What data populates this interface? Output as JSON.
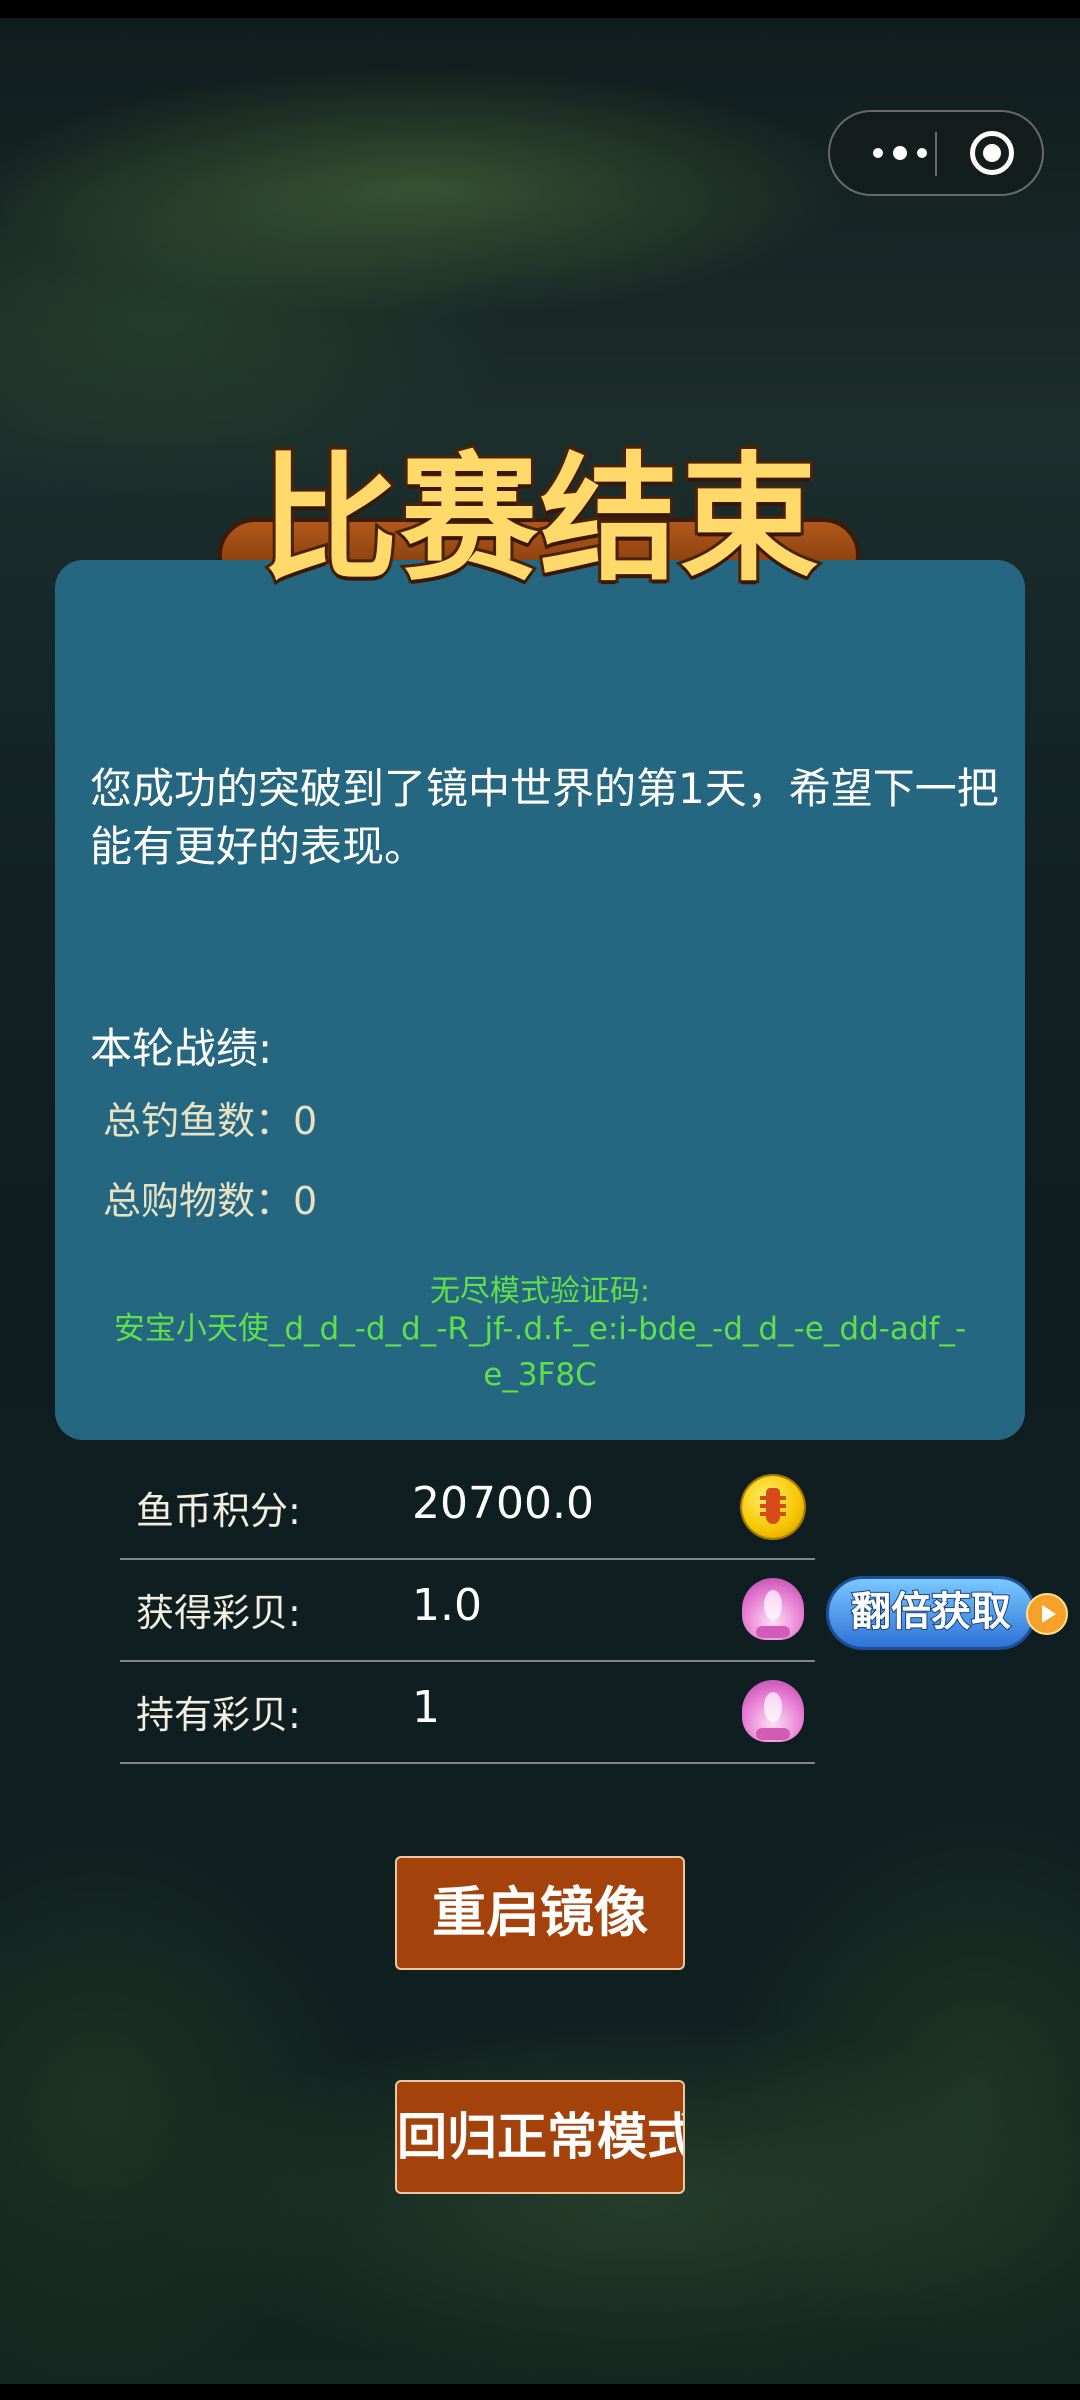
{
  "banner": {
    "title": "比赛结束"
  },
  "panel": {
    "message": "您成功的突破到了镜中世界的第1天，希望下一把能有更好的表现。",
    "record_title": "本轮战绩:",
    "stats": [
      {
        "label": "总钓鱼数：",
        "value": "0"
      },
      {
        "label": "总购物数：",
        "value": "0"
      }
    ],
    "code_label": "无尽模式验证码:",
    "code_value": "安宝小天使_d_d_-d_d_-R_jf-.d.f-_e:i-bde_-d_d_-e_dd-adf_-e_3F8C"
  },
  "scores": [
    {
      "label": "鱼币积分:",
      "value": "20700.0",
      "icon": "coin-icon"
    },
    {
      "label": "获得彩贝:",
      "value": "1.0",
      "icon": "shell-icon"
    },
    {
      "label": "持有彩贝:",
      "value": "1",
      "icon": "shell-icon"
    }
  ],
  "double_button": {
    "label": "翻倍获取",
    "icon": "play-icon"
  },
  "actions": {
    "restart_label": "重启镜像",
    "return_label": "回归正常模式"
  },
  "capsule": {
    "more_icon": "more-dots-icon",
    "close_icon": "target-icon"
  },
  "colors": {
    "panel": "#256781",
    "code": "#5ee04a",
    "button": "#a4420b",
    "banner_text": "#ffd96a"
  }
}
